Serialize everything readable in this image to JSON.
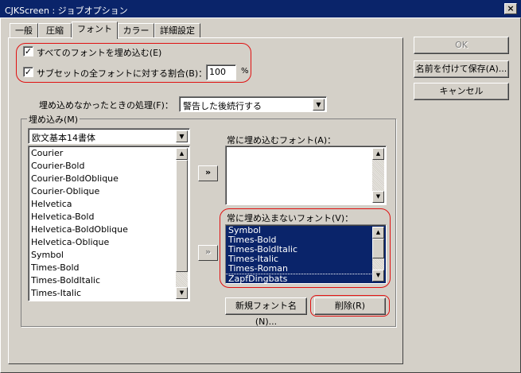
{
  "window": {
    "title": "CJKScreen : ジョブオプション",
    "close_glyph": "×"
  },
  "tabs": [
    {
      "label": "一般"
    },
    {
      "label": "圧縮"
    },
    {
      "label": "フォント"
    },
    {
      "label": "カラー"
    },
    {
      "label": "詳細設定"
    }
  ],
  "right_buttons": {
    "ok": "OK",
    "save_as": "名前を付けて保存(A)...",
    "cancel": "キャンセル"
  },
  "fonts_tab": {
    "embed_all": {
      "label": "すべてのフォントを埋め込む(E)",
      "checked": true
    },
    "subset": {
      "label": "サブセットの全フォントに対する割合(B)：",
      "checked": true,
      "value": "100",
      "unit": "%"
    },
    "on_fail": {
      "label": "埋め込めなかったときの処理(F)：",
      "value": "警告した後続行する"
    },
    "embed_group": {
      "title": "埋め込み(M)",
      "source_select": "欧文基本14書体",
      "source_fonts": [
        "Courier",
        "Courier-Bold",
        "Courier-BoldOblique",
        "Courier-Oblique",
        "Helvetica",
        "Helvetica-Bold",
        "Helvetica-BoldOblique",
        "Helvetica-Oblique",
        "Symbol",
        "Times-Bold",
        "Times-BoldItalic",
        "Times-Italic"
      ],
      "add_always_glyph": "»",
      "add_never_glyph": "»",
      "always_label": "常に埋め込むフォント(A)：",
      "always_fonts": [],
      "never_label": "常に埋め込まないフォント(V)：",
      "never_fonts": [
        "Symbol",
        "Times-Bold",
        "Times-BoldItalic",
        "Times-Italic",
        "Times-Roman",
        "ZapfDingbats"
      ],
      "new_font_button": "新規フォント名(N)...",
      "delete_button": "削除(R)"
    }
  },
  "colors": {
    "title_bar": "#0a246a",
    "selection": "#0a246a",
    "highlight_outline": "#e01010",
    "face": "#d4d0c8"
  }
}
